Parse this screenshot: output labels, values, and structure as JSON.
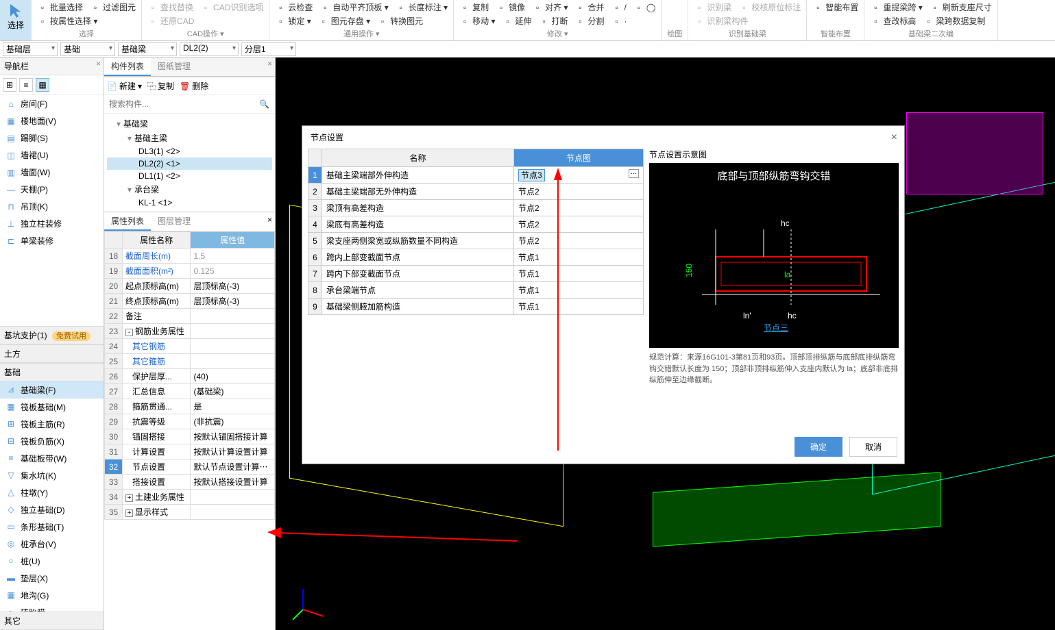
{
  "ribbon": {
    "select_label": "选择",
    "groups": [
      {
        "label": "选择",
        "items": [
          [
            "批量选择",
            "过滤图元"
          ],
          [
            "按属性选择 ▾",
            ""
          ]
        ]
      },
      {
        "label": "CAD操作 ▾",
        "items": [
          [
            "查找替换",
            "CAD识别选项"
          ],
          [
            "还原CAD",
            ""
          ]
        ],
        "disabled": true
      },
      {
        "label": "通用操作 ▾",
        "items": [
          [
            "云检查",
            "自动平齐顶板 ▾",
            "长度标注 ▾"
          ],
          [
            "锁定 ▾",
            "图元存盘 ▾",
            "转换图元"
          ]
        ]
      },
      {
        "label": "修改 ▾",
        "items": [
          [
            "复制",
            "镜像",
            "对齐 ▾",
            "合并",
            "/",
            "◯"
          ],
          [
            "移动 ▾",
            "延伸",
            "打断",
            "分割",
            "·",
            ""
          ]
        ]
      },
      {
        "label": "绘图",
        "items": []
      },
      {
        "label": "识别基础梁",
        "items": [
          [
            "识别梁",
            "校核原位标注"
          ],
          [
            "识别梁构件",
            ""
          ]
        ],
        "disabled": true
      },
      {
        "label": "智能布置",
        "items": [
          [
            "智能布置"
          ]
        ]
      },
      {
        "label": "基础梁二次编",
        "items": [
          [
            "重提梁跨 ▾",
            "刷新支座尺寸",
            ""
          ],
          [
            "查改标高",
            "梁跨数据复制",
            ""
          ]
        ]
      }
    ]
  },
  "dropdown_bar": [
    "基础层",
    "基础",
    "基础梁",
    "DL2(2)",
    "分层1"
  ],
  "nav": {
    "title": "导航栏",
    "items_top": [
      {
        "icon": "⌂",
        "label": "房间(F)"
      },
      {
        "icon": "▦",
        "label": "楼地面(V)"
      },
      {
        "icon": "▤",
        "label": "踢脚(S)"
      },
      {
        "icon": "◫",
        "label": "墙裙(U)"
      },
      {
        "icon": "▥",
        "label": "墙面(W)"
      },
      {
        "icon": "—",
        "label": "天棚(P)"
      },
      {
        "icon": "⊓",
        "label": "吊顶(K)"
      },
      {
        "icon": "⊥",
        "label": "独立柱装修"
      },
      {
        "icon": "⊏",
        "label": "单梁装修"
      }
    ],
    "section_pit": "基坑支护(1)",
    "trial": "免费试用",
    "section_earth": "土方",
    "section_foundation": "基础",
    "items_foundation": [
      {
        "icon": "⊿",
        "label": "基础梁(F)",
        "active": true
      },
      {
        "icon": "▦",
        "label": "筏板基础(M)"
      },
      {
        "icon": "⊞",
        "label": "筏板主筋(R)"
      },
      {
        "icon": "⊟",
        "label": "筏板负筋(X)"
      },
      {
        "icon": "≡",
        "label": "基础板带(W)"
      },
      {
        "icon": "▽",
        "label": "集水坑(K)"
      },
      {
        "icon": "△",
        "label": "柱墩(Y)"
      },
      {
        "icon": "◇",
        "label": "独立基础(D)"
      },
      {
        "icon": "▭",
        "label": "条形基础(T)"
      },
      {
        "icon": "◎",
        "label": "桩承台(V)"
      },
      {
        "icon": "○",
        "label": "桩(U)"
      },
      {
        "icon": "▬",
        "label": "垫层(X)"
      },
      {
        "icon": "▦",
        "label": "地沟(G)"
      },
      {
        "icon": "◐",
        "label": "砖胎膜"
      }
    ],
    "section_other": "其它"
  },
  "component_panel": {
    "tabs": [
      "构件列表",
      "图纸管理"
    ],
    "toolbar": [
      "新建",
      "复制",
      "删除"
    ],
    "search_placeholder": "搜索构件...",
    "tree": [
      {
        "lv": 1,
        "label": "基础梁",
        "toggle": "▾"
      },
      {
        "lv": 2,
        "label": "基础主梁",
        "toggle": "▾"
      },
      {
        "lv": 3,
        "label": "DL3(1) <2>"
      },
      {
        "lv": 3,
        "label": "DL2(2) <1>",
        "selected": true
      },
      {
        "lv": 3,
        "label": "DL1(1) <2>"
      },
      {
        "lv": 2,
        "label": "承台梁",
        "toggle": "▾"
      },
      {
        "lv": 3,
        "label": "KL-1 <1>"
      }
    ]
  },
  "property_panel": {
    "tabs": [
      "属性列表",
      "图层管理"
    ],
    "name_header": "属性名称",
    "value_header": "属性值",
    "rows": [
      {
        "n": "18",
        "name": "截面周长(m)",
        "val": "1.5",
        "link": true,
        "gray": true
      },
      {
        "n": "19",
        "name": "截面面积(m²)",
        "val": "0.125",
        "link": true,
        "gray": true
      },
      {
        "n": "20",
        "name": "起点顶标高(m)",
        "val": "层顶标高(-3)"
      },
      {
        "n": "21",
        "name": "终点顶标高(m)",
        "val": "层顶标高(-3)"
      },
      {
        "n": "22",
        "name": "备注",
        "val": ""
      },
      {
        "n": "23",
        "name": "钢筋业务属性",
        "val": "",
        "expand": "-"
      },
      {
        "n": "24",
        "name": "其它钢筋",
        "val": "",
        "link": true,
        "indent": true
      },
      {
        "n": "25",
        "name": "其它箍筋",
        "val": "",
        "link": true,
        "indent": true
      },
      {
        "n": "26",
        "name": "保护层厚...",
        "val": "(40)",
        "indent": true
      },
      {
        "n": "27",
        "name": "汇总信息",
        "val": "(基础梁)",
        "indent": true
      },
      {
        "n": "28",
        "name": "箍筋贯通...",
        "val": "是",
        "indent": true
      },
      {
        "n": "29",
        "name": "抗震等级",
        "val": "(非抗震)",
        "indent": true
      },
      {
        "n": "30",
        "name": "锚固搭接",
        "val": "按默认锚固搭接计算",
        "indent": true
      },
      {
        "n": "31",
        "name": "计算设置",
        "val": "按默认计算设置计算",
        "indent": true
      },
      {
        "n": "32",
        "name": "节点设置",
        "val": "默认节点设置计算",
        "indent": true,
        "selected": true,
        "ellipsis": true
      },
      {
        "n": "33",
        "name": "搭接设置",
        "val": "按默认搭接设置计算",
        "indent": true
      },
      {
        "n": "34",
        "name": "土建业务属性",
        "val": "",
        "expand": "+"
      },
      {
        "n": "35",
        "name": "显示样式",
        "val": "",
        "expand": "+"
      }
    ]
  },
  "dialog": {
    "title": "节点设置",
    "col_name": "名称",
    "col_node": "节点图",
    "rows": [
      {
        "n": "1",
        "name": "基础主梁端部外伸构造",
        "node": "节点3",
        "sel": true,
        "edit": true
      },
      {
        "n": "2",
        "name": "基础主梁端部无外伸构造",
        "node": "节点2"
      },
      {
        "n": "3",
        "name": "梁顶有高差构造",
        "node": "节点2"
      },
      {
        "n": "4",
        "name": "梁底有高差构造",
        "node": "节点2"
      },
      {
        "n": "5",
        "name": "梁支座两侧梁宽或纵筋数量不同构造",
        "node": "节点2"
      },
      {
        "n": "6",
        "name": "跨内上部变截面节点",
        "node": "节点1"
      },
      {
        "n": "7",
        "name": "跨内下部变截面节点",
        "node": "节点1"
      },
      {
        "n": "8",
        "name": "承台梁端节点",
        "node": "节点1"
      },
      {
        "n": "9",
        "name": "基础梁侧腋加筋构造",
        "node": "节点1"
      }
    ],
    "schematic_label": "节点设置示意图",
    "schematic_title": "底部与顶部纵筋弯钩交错",
    "schematic_dims": {
      "hc_top": "hc",
      "v150": "150",
      "la": "la",
      "ln": "ln'",
      "hc_bot": "hc",
      "node_link": "节点三"
    },
    "note": "规范计算：来源16G101-3第81页和93页。顶部顶排纵筋与底部底排纵筋弯钩交错默认长度为 150；顶部非顶排纵筋伸入支座内默认为 la；底部非底排纵筋伸至边缘截断。",
    "ok": "确定",
    "cancel": "取消"
  }
}
